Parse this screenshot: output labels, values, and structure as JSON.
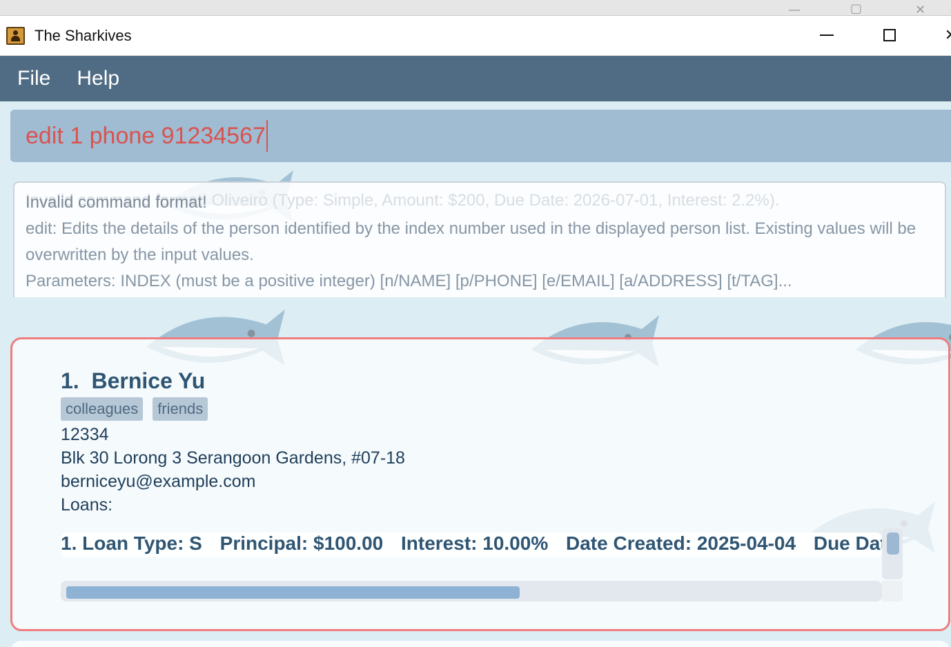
{
  "window": {
    "title": "The Sharkives",
    "icon": "address-book-icon"
  },
  "menu": {
    "items": [
      {
        "label": "File"
      },
      {
        "label": "Help"
      }
    ]
  },
  "command": {
    "value": "edit 1 phone 91234567",
    "text_color": "#d9534f"
  },
  "result": {
    "ghost_text": "Invalid command format! Oliveiro (Type: Simple, Amount: $200, Due Date: 2026-07-01, Interest: 2.2%).",
    "lines": [
      "Invalid command format!",
      "edit: Edits the details of the person identified by the index number used in the displayed person list. Existing values will be",
      "overwritten by the input values.",
      "Parameters: INDEX (must be a positive integer) [n/NAME] [p/PHONE] [e/EMAIL] [a/ADDRESS] [t/TAG]..."
    ]
  },
  "person": {
    "index": "1.",
    "name": "Bernice Yu",
    "tags": [
      "colleagues",
      "friends"
    ],
    "phone": "12334",
    "address": "Blk 30 Lorong 3 Serangoon Gardens, #07-18",
    "email": "berniceyu@example.com",
    "loans_label": "Loans:",
    "loan": {
      "type": "1. Loan Type: S",
      "principal": "Principal: $100.00",
      "interest": "Interest: 10.00%",
      "date_created": "Date Created: 2025-04-04",
      "due_date": "Due Date:"
    },
    "hscroll_fraction": 0.56
  },
  "colors": {
    "menubar": "#506c84",
    "card_border": "#f07c7f",
    "name": "#2f5573"
  }
}
